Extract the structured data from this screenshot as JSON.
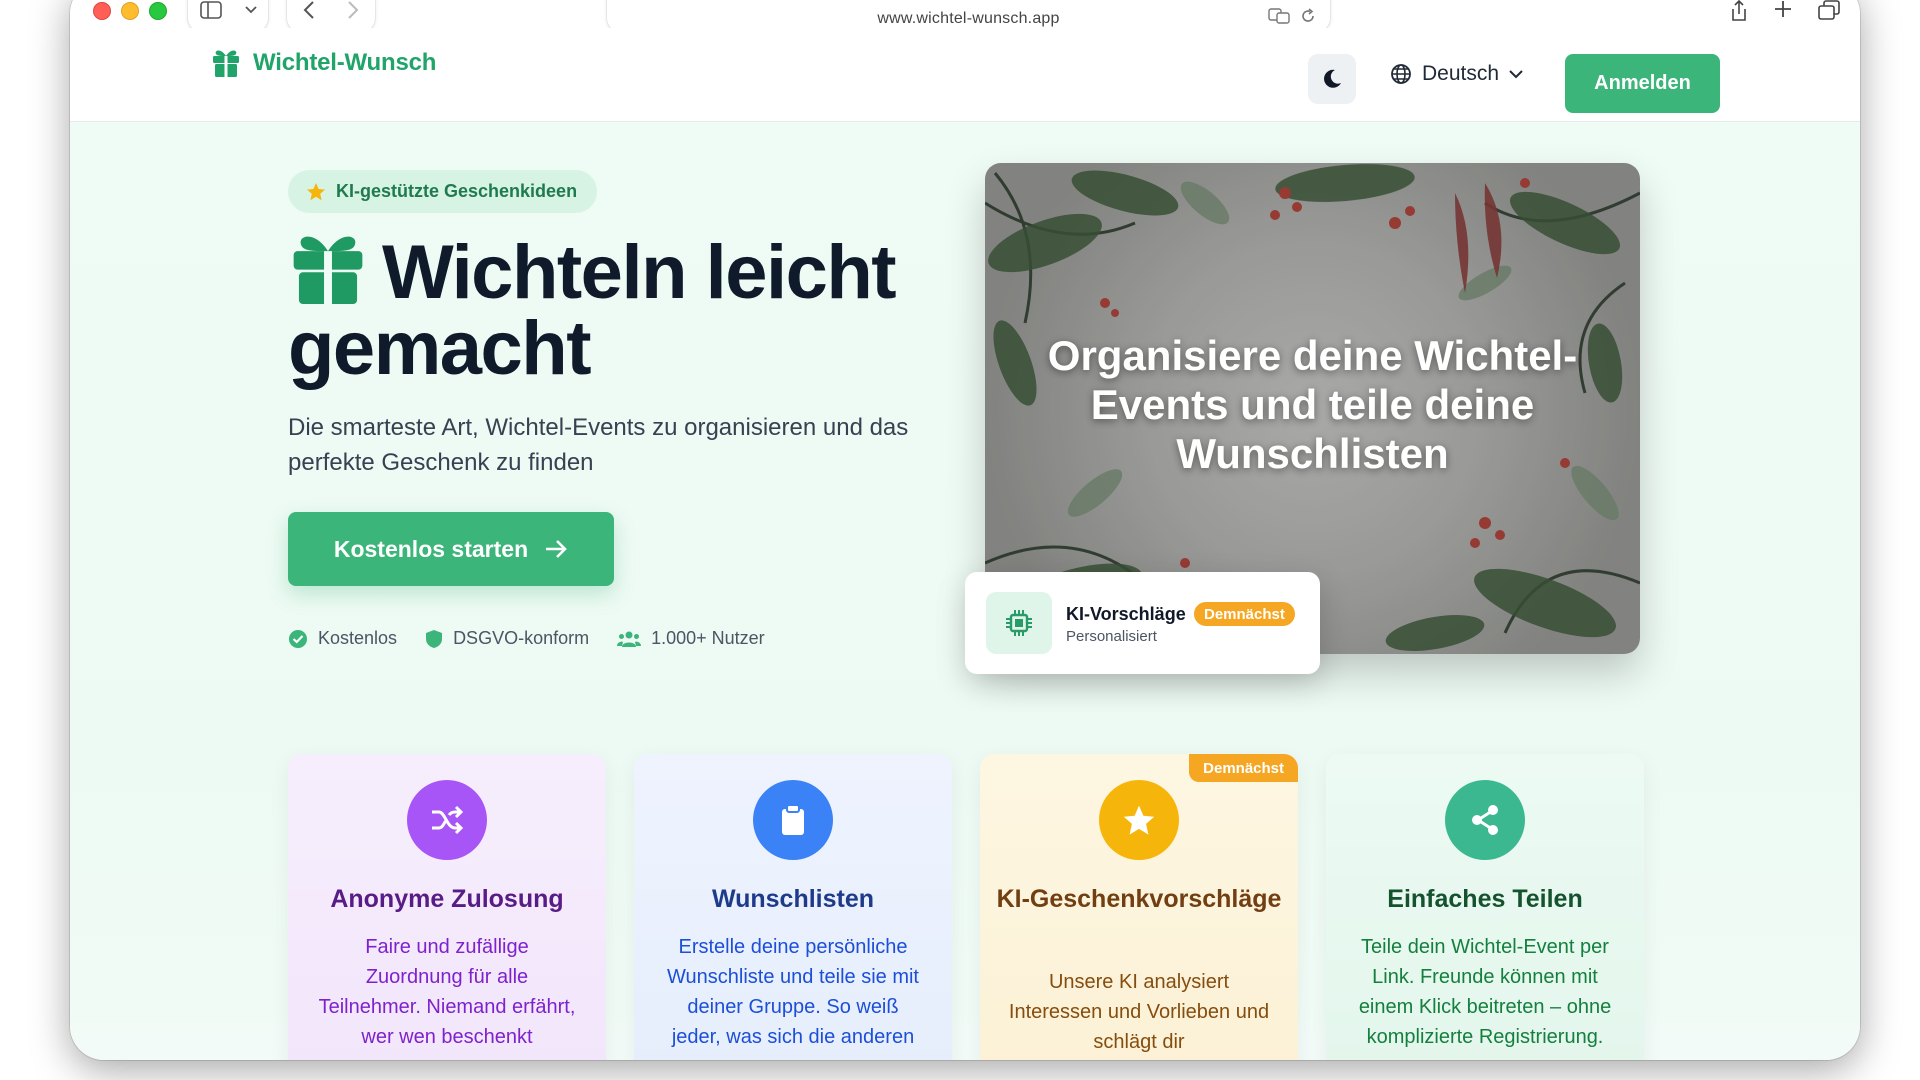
{
  "browser": {
    "url": "www.wichtel-wunsch.app"
  },
  "nav": {
    "brand": "Wichtel-Wunsch",
    "language": "Deutsch",
    "login_label": "Anmelden"
  },
  "hero": {
    "badge": "KI-gestützte Geschenkideen",
    "title": "Wichteln leicht gemacht",
    "subtitle": "Die smarteste Art, Wichtel-Events zu organisieren und das perfekte Geschenk zu finden",
    "cta_label": "Kostenlos starten",
    "trust": [
      {
        "label": "Kostenlos",
        "icon": "check-circle-icon"
      },
      {
        "label": "DSGVO-konform",
        "icon": "shield-icon"
      },
      {
        "label": "1.000+ Nutzer",
        "icon": "users-icon"
      }
    ],
    "image_caption": "Organisiere deine Wichtel-Events und teile deine Wunschlisten",
    "float_card": {
      "title": "KI-Vorschläge",
      "badge": "Demnächst",
      "subtitle": "Personalisiert"
    }
  },
  "features": [
    {
      "title": "Anonyme Zulosung",
      "description": "Faire und zufällige Zuordnung für alle Teilnehmer. Niemand erfährt, wer wen beschenkt",
      "icon": "shuffle-icon",
      "color": "#a855f7",
      "title_color": "#581c87",
      "desc_color": "#7e22ce"
    },
    {
      "title": "Wunschlisten",
      "description": "Erstelle deine persönliche Wunschliste und teile sie mit deiner Gruppe. So weiß jeder, was sich die anderen",
      "icon": "clipboard-icon",
      "color": "#3b82f6",
      "title_color": "#1e3a8a",
      "desc_color": "#1d4ed8"
    },
    {
      "title": "KI-Geschenkvorschläge",
      "description": "Unsere KI analysiert Interessen und Vorlieben und schlägt dir",
      "icon": "star-icon",
      "badge": "Demnächst",
      "color": "#f5b50a",
      "title_color": "#713f12",
      "desc_color": "#854d0e"
    },
    {
      "title": "Einfaches Teilen",
      "description": "Teile dein Wichtel-Event per Link. Freunde können mit einem Klick beitreten – ohne komplizierte Registrierung.",
      "icon": "share-icon",
      "color": "#3bb890",
      "title_color": "#14532d",
      "desc_color": "#15803d"
    }
  ],
  "colors": {
    "brand_green": "#21a46a",
    "button_green": "#3bb57a",
    "accent_orange": "#f5a623"
  }
}
